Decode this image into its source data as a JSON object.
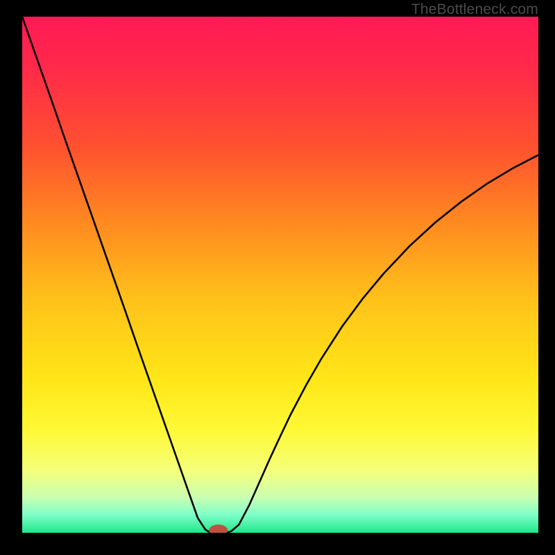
{
  "watermark": "TheBottleneck.com",
  "chart_data": {
    "type": "line",
    "title": "",
    "xlabel": "",
    "ylabel": "",
    "xlim": [
      0,
      100
    ],
    "ylim": [
      0,
      100
    ],
    "background_gradient_stops": [
      {
        "offset": 0.0,
        "color": "#ff1a55"
      },
      {
        "offset": 0.1,
        "color": "#ff2a4a"
      },
      {
        "offset": 0.25,
        "color": "#ff5030"
      },
      {
        "offset": 0.4,
        "color": "#ff8a20"
      },
      {
        "offset": 0.55,
        "color": "#ffc21a"
      },
      {
        "offset": 0.7,
        "color": "#ffe617"
      },
      {
        "offset": 0.8,
        "color": "#fff835"
      },
      {
        "offset": 0.88,
        "color": "#f4ff7a"
      },
      {
        "offset": 0.93,
        "color": "#ccffb0"
      },
      {
        "offset": 0.965,
        "color": "#7fffc8"
      },
      {
        "offset": 1.0,
        "color": "#1fe68a"
      }
    ],
    "series": [
      {
        "name": "bottleneck-curve",
        "color": "#000000",
        "stroke_width": 2.6,
        "x": [
          0,
          2,
          4,
          6,
          8,
          10,
          12,
          14,
          16,
          18,
          20,
          22,
          24,
          26,
          28,
          30,
          32,
          34,
          35.5,
          36.5,
          37.5,
          38.5,
          39.5,
          40.5,
          42,
          44,
          46,
          48,
          50,
          52,
          55,
          58,
          62,
          66,
          70,
          75,
          80,
          85,
          90,
          95,
          100
        ],
        "y": [
          100,
          94.3,
          88.6,
          82.9,
          77.1,
          71.4,
          65.7,
          60.0,
          54.3,
          48.6,
          42.9,
          37.1,
          31.4,
          25.7,
          20.0,
          14.3,
          8.6,
          2.9,
          0.6,
          0.0,
          0.0,
          0.0,
          0.0,
          0.3,
          1.6,
          5.4,
          9.9,
          14.4,
          18.7,
          22.9,
          28.6,
          33.8,
          40.0,
          45.4,
          50.2,
          55.5,
          60.1,
          64.1,
          67.6,
          70.6,
          73.2
        ]
      }
    ],
    "marker": {
      "name": "optimal-point",
      "x": 38,
      "y": 0.5,
      "rx": 1.8,
      "ry": 1.1,
      "color": "#c0513f"
    }
  }
}
